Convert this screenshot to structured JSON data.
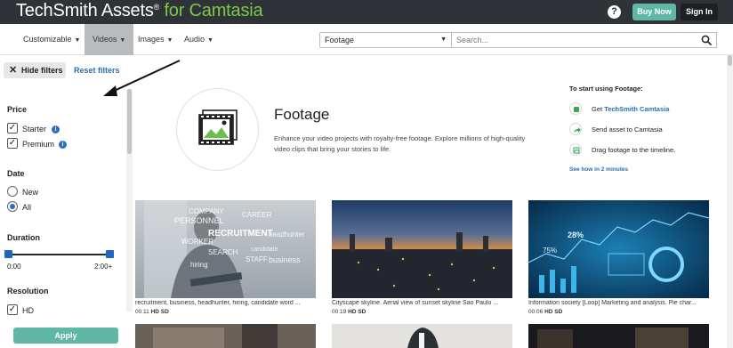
{
  "header": {
    "logo_main": "TechSmith Assets",
    "logo_reg": "®",
    "logo_for": " for Camtasia",
    "help_icon": "?",
    "buy_now": "Buy Now",
    "sign_in": "Sign In"
  },
  "nav": {
    "items": [
      {
        "label": "Customizable",
        "caret": "▼"
      },
      {
        "label": "Videos",
        "caret": "▼"
      },
      {
        "label": "Images",
        "caret": "▼"
      },
      {
        "label": "Audio",
        "caret": "▼"
      }
    ],
    "active_index": 1
  },
  "search": {
    "category_value": "Footage",
    "category_caret": "▼",
    "placeholder": "Search..."
  },
  "filters": {
    "hide_label": "Hide filters",
    "hide_icon": "✕",
    "reset_label": "Reset filters",
    "price": {
      "heading": "Price",
      "options": [
        {
          "label": "Starter",
          "checked": true,
          "info": "i"
        },
        {
          "label": "Premium",
          "checked": true,
          "info": "i"
        }
      ]
    },
    "date": {
      "heading": "Date",
      "options": [
        {
          "label": "New",
          "selected": false
        },
        {
          "label": "All",
          "selected": true
        }
      ]
    },
    "duration": {
      "heading": "Duration",
      "min_label": "0:00",
      "max_label": "2:00+",
      "range_low": 0,
      "range_high": 1
    },
    "resolution": {
      "heading": "Resolution",
      "options": [
        {
          "label": "HD",
          "checked": true
        }
      ]
    },
    "apply_label": "Apply",
    "check_glyph": "✓"
  },
  "hero": {
    "title": "Footage",
    "description": "Enhance your video projects with royalty-free footage. Explore millions of high-quality video clips that bring your stories to life.",
    "start_heading": "To start using Footage:",
    "steps": [
      {
        "prefix": "Get ",
        "link": "TechSmith Camtasia",
        "icon": "camtasia-icon"
      },
      {
        "prefix": "Send asset to Camtasia",
        "link": "",
        "icon": "share-arrow-icon"
      },
      {
        "prefix": "Drag footage to the timeline.",
        "link": "",
        "icon": "timeline-icon"
      }
    ],
    "see_how": "See how in 2 minutes"
  },
  "results": [
    {
      "title": "recruitment, business, headhunter, hiring, candidate word ...",
      "duration": "00:11",
      "badge": "HD SD",
      "overlay_words": [
        "COMPANY",
        "CAREER",
        "PERSONNEL",
        "RECRUITMENT",
        "headhunter",
        "WORKER",
        "SEARCH",
        "STAFF",
        "business",
        "hiring",
        "candidate"
      ]
    },
    {
      "title": "Cityscape skyline. Aerial view of sunset skyline Sao Paulo ...",
      "duration": "00:19",
      "badge": "HD SD"
    },
    {
      "title": "Information society [Loop] Marketing and analysis. Pie char...",
      "duration": "00:06",
      "badge": "HD SD",
      "overlay_words": [
        "28%",
        "75%"
      ]
    }
  ],
  "colors": {
    "topbar": "#2f3236",
    "accent_green": "#7cc94a",
    "button_teal": "#5fb7a4",
    "link_blue": "#2a6fb0",
    "nav_active": "#b9bcbf"
  }
}
